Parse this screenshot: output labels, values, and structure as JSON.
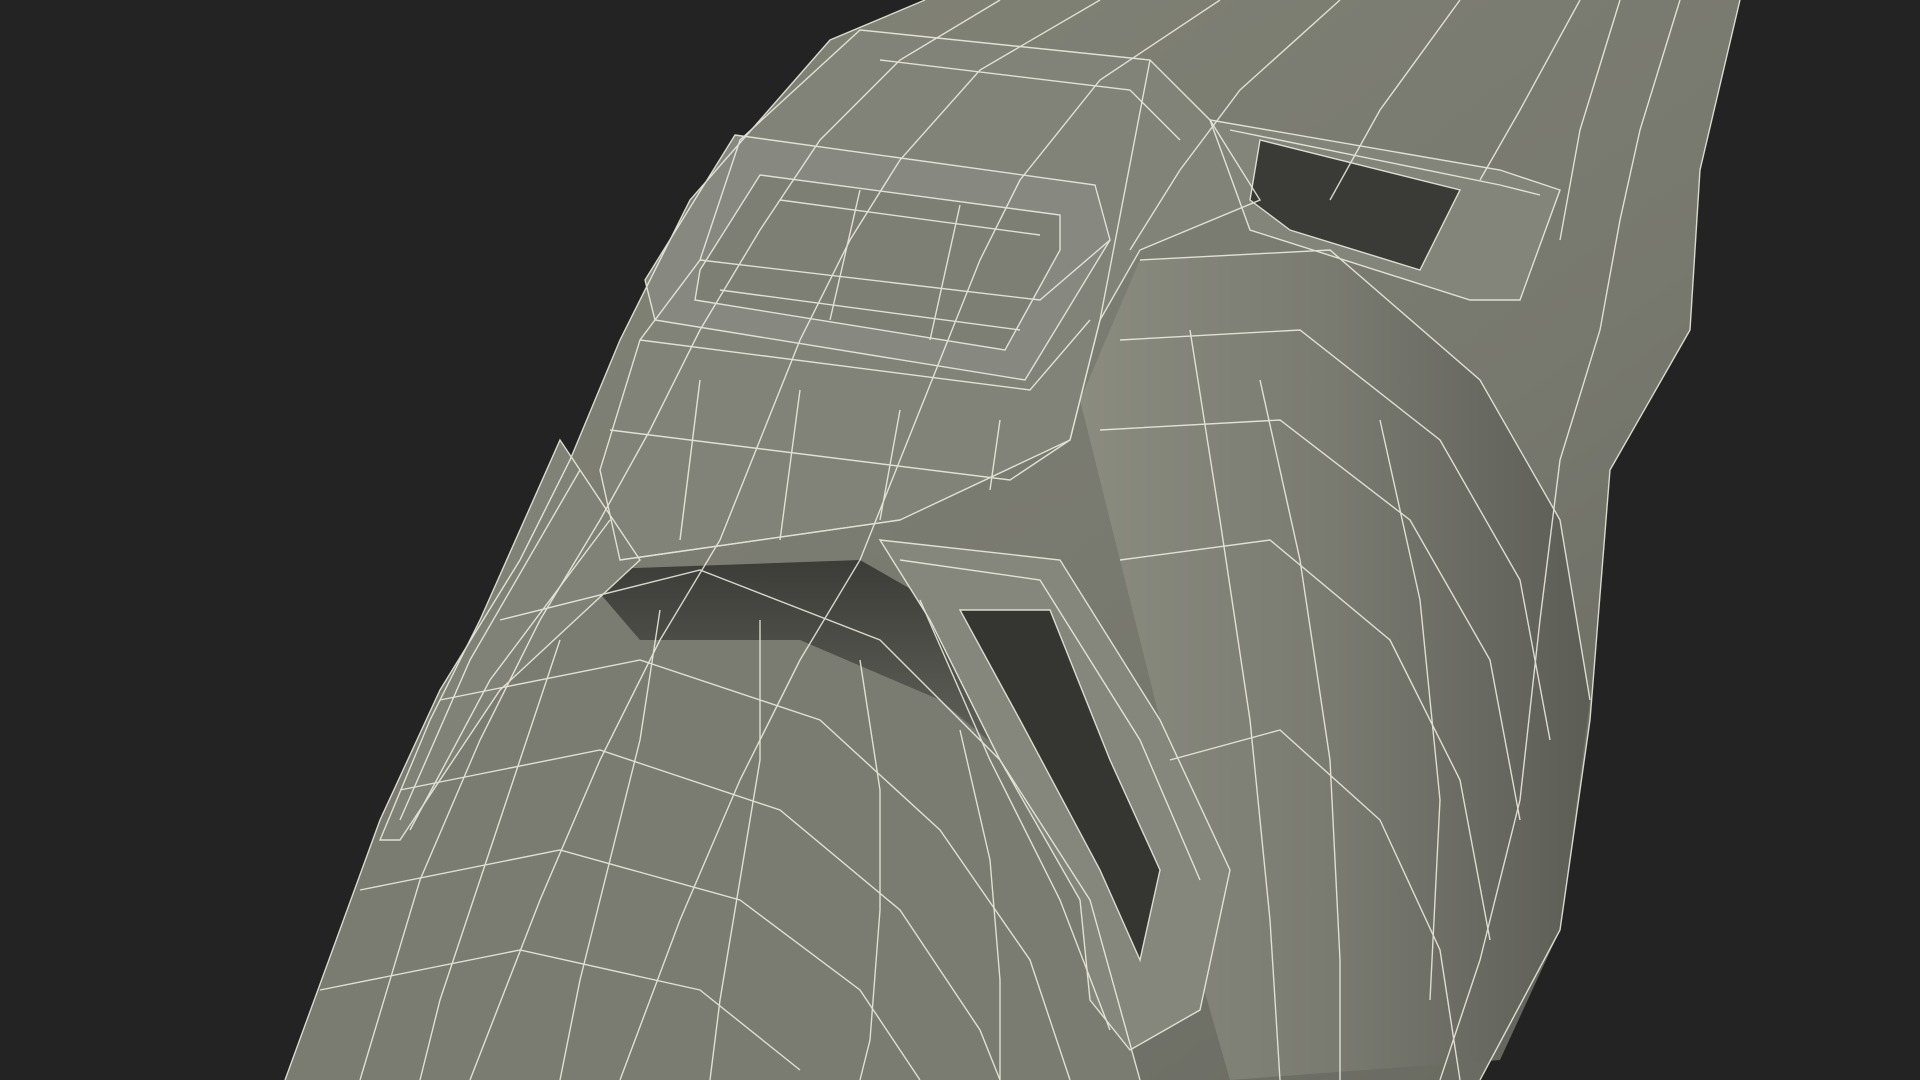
{
  "scene": {
    "subject": "wireframe-mesh-render",
    "colors": {
      "background": "#232323",
      "surface_light": "#8a8b80",
      "surface_mid": "#76776d",
      "surface_dark": "#5f6058",
      "surface_shadow": "#3a3b36",
      "cavity": "#2c2d2a",
      "wire": "#f1f1e4"
    }
  }
}
